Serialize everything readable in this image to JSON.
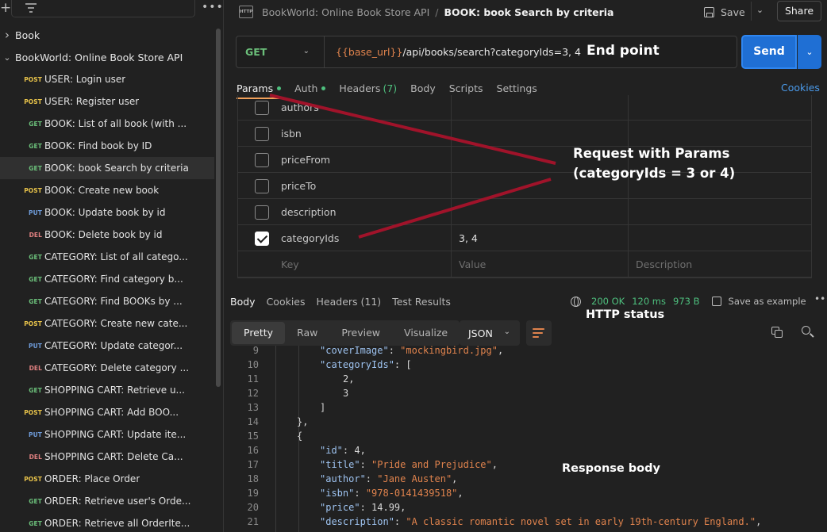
{
  "sidebar": {
    "collections": [
      {
        "name": "Book",
        "expanded": false
      },
      {
        "name": "BookWorld: Online Book Store API",
        "expanded": true
      }
    ],
    "requests": [
      {
        "method": "POST",
        "name": "USER: Login user"
      },
      {
        "method": "POST",
        "name": "USER: Register user"
      },
      {
        "method": "GET",
        "name": "BOOK: List of all book (with ..."
      },
      {
        "method": "GET",
        "name": "BOOK: Find book by ID"
      },
      {
        "method": "GET",
        "name": "BOOK: book Search by criteria",
        "active": true
      },
      {
        "method": "POST",
        "name": "BOOK: Create new book"
      },
      {
        "method": "PUT",
        "name": "BOOK: Update book by id"
      },
      {
        "method": "DEL",
        "name": "BOOK: Delete book by id"
      },
      {
        "method": "GET",
        "name": "CATEGORY: List of all catego..."
      },
      {
        "method": "GET",
        "name": "CATEGORY: Find category b..."
      },
      {
        "method": "GET",
        "name": "CATEGORY: Find BOOKs by ..."
      },
      {
        "method": "POST",
        "name": "CATEGORY: Create new cate..."
      },
      {
        "method": "PUT",
        "name": "CATEGORY: Update categor..."
      },
      {
        "method": "DEL",
        "name": "CATEGORY: Delete category ..."
      },
      {
        "method": "GET",
        "name": "SHOPPING CART: Retrieve u..."
      },
      {
        "method": "POST",
        "name": "SHOPPING CART: Add BOO..."
      },
      {
        "method": "PUT",
        "name": "SHOPPING CART: Update ite..."
      },
      {
        "method": "DEL",
        "name": "SHOPPING CART: Delete Ca..."
      },
      {
        "method": "POST",
        "name": "ORDER: Place Order"
      },
      {
        "method": "GET",
        "name": "ORDER: Retrieve user's Orde..."
      },
      {
        "method": "GET",
        "name": "ORDER: Retrieve all OrderIte..."
      }
    ]
  },
  "header": {
    "http_icon": "HTTP",
    "collection": "BookWorld: Online Book Store API",
    "separator": "/",
    "request": "BOOK: book Search by criteria",
    "save_label": "Save",
    "share_label": "Share"
  },
  "request": {
    "method": "GET",
    "url_var": "{{base_url}}",
    "url_path": "/api/books/search?categoryIds=3, 4",
    "send_label": "Send"
  },
  "request_tabs": [
    {
      "label": "Params",
      "dot": true,
      "selected": true
    },
    {
      "label": "Auth",
      "dot": true
    },
    {
      "label": "Headers",
      "count": "(7)"
    },
    {
      "label": "Body"
    },
    {
      "label": "Scripts"
    },
    {
      "label": "Settings"
    }
  ],
  "cookies_label": "Cookies",
  "params": [
    {
      "key": "authors",
      "value": "",
      "description": "",
      "checked": false
    },
    {
      "key": "isbn",
      "value": "",
      "description": "",
      "checked": false
    },
    {
      "key": "priceFrom",
      "value": "",
      "description": "",
      "checked": false
    },
    {
      "key": "priceTo",
      "value": "",
      "description": "",
      "checked": false
    },
    {
      "key": "description",
      "value": "",
      "description": "",
      "checked": false
    },
    {
      "key": "categoryIds",
      "value": "3, 4",
      "description": "",
      "checked": true
    }
  ],
  "params_placeholder": {
    "key": "Key",
    "value": "Value",
    "description": "Description"
  },
  "response_tabs": [
    "Body",
    "Cookies",
    "Headers (11)",
    "Test Results"
  ],
  "response_status": {
    "code": "200 OK",
    "time": "120 ms",
    "size": "973 B",
    "save_label": "Save as example",
    "more": "•••"
  },
  "view_tabs": [
    "Pretty",
    "Raw",
    "Preview",
    "Visualize"
  ],
  "format": "JSON",
  "code_lines": [
    {
      "n": "9",
      "indent": 4,
      "parts": [
        [
          "key",
          "\"coverImage\""
        ],
        [
          "p",
          ": "
        ],
        [
          "str",
          "\"mockingbird.jpg\""
        ],
        [
          "p",
          ","
        ]
      ]
    },
    {
      "n": "10",
      "indent": 4,
      "parts": [
        [
          "key",
          "\"categoryIds\""
        ],
        [
          "p",
          ": ["
        ]
      ]
    },
    {
      "n": "11",
      "indent": 6,
      "parts": [
        [
          "num",
          "2"
        ],
        [
          "p",
          ","
        ]
      ]
    },
    {
      "n": "12",
      "indent": 6,
      "parts": [
        [
          "num",
          "3"
        ]
      ]
    },
    {
      "n": "13",
      "indent": 4,
      "parts": [
        [
          "p",
          "]"
        ]
      ]
    },
    {
      "n": "14",
      "indent": 2,
      "parts": [
        [
          "p",
          "},"
        ]
      ]
    },
    {
      "n": "15",
      "indent": 2,
      "parts": [
        [
          "p",
          "{"
        ]
      ]
    },
    {
      "n": "16",
      "indent": 4,
      "parts": [
        [
          "key",
          "\"id\""
        ],
        [
          "p",
          ": "
        ],
        [
          "num",
          "4"
        ],
        [
          "p",
          ","
        ]
      ]
    },
    {
      "n": "17",
      "indent": 4,
      "parts": [
        [
          "key",
          "\"title\""
        ],
        [
          "p",
          ": "
        ],
        [
          "str",
          "\"Pride and Prejudice\""
        ],
        [
          "p",
          ","
        ]
      ]
    },
    {
      "n": "18",
      "indent": 4,
      "parts": [
        [
          "key",
          "\"author\""
        ],
        [
          "p",
          ": "
        ],
        [
          "str",
          "\"Jane Austen\""
        ],
        [
          "p",
          ","
        ]
      ]
    },
    {
      "n": "19",
      "indent": 4,
      "parts": [
        [
          "key",
          "\"isbn\""
        ],
        [
          "p",
          ": "
        ],
        [
          "str",
          "\"978-0141439518\""
        ],
        [
          "p",
          ","
        ]
      ]
    },
    {
      "n": "20",
      "indent": 4,
      "parts": [
        [
          "key",
          "\"price\""
        ],
        [
          "p",
          ": "
        ],
        [
          "num",
          "14.99"
        ],
        [
          "p",
          ","
        ]
      ]
    },
    {
      "n": "21",
      "indent": 4,
      "parts": [
        [
          "key",
          "\"description\""
        ],
        [
          "p",
          ": "
        ],
        [
          "str",
          "\"A classic romantic novel set in early 19th-century England.\""
        ],
        [
          "p",
          ","
        ]
      ]
    }
  ],
  "annotations": {
    "endpoint": "End point",
    "params_line1": "Request with Params",
    "params_line2": "(categoryIds = 3 or 4)",
    "http_status": "HTTP status",
    "response_body": "Response body",
    "arrow_color": "#a0132a"
  },
  "colors": {
    "send": "#1f6fd4",
    "get": "#6bbf7a",
    "post": "#e8c34a",
    "put": "#6e9bd9",
    "delete": "#e08080",
    "accent_tab": "#f0a05a"
  }
}
